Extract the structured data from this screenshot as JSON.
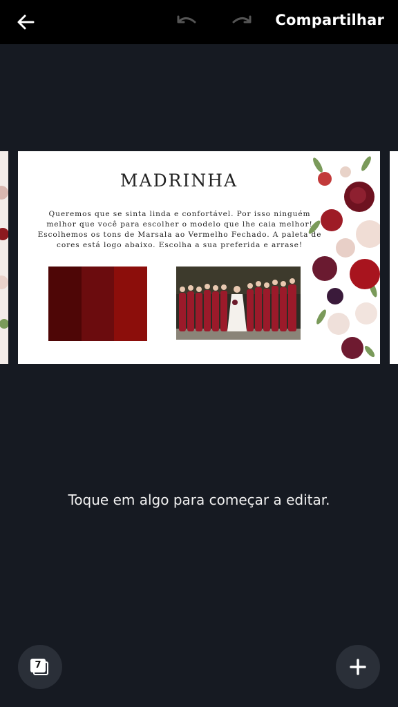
{
  "topbar": {
    "back_icon": "arrow-left-icon",
    "undo_icon": "undo-icon",
    "redo_icon": "redo-icon",
    "share_label": "Compartilhar"
  },
  "design": {
    "title": "MADRINHA",
    "description": "Queremos que se sinta linda e confortável. Por isso ninguém melhor que você para escolher o modelo que lhe caia melhor! Escolhemos os tons de Marsala ao Vermelho Fechado. A paleta de cores está logo abaixo. Escolha a sua preferida e arrase!",
    "palette": [
      "#4e0606",
      "#6b0c0e",
      "#8c0e0b"
    ]
  },
  "editor": {
    "hint": "Toque em algo para começar a editar.",
    "pages_count": "7",
    "pages_icon": "pages-icon",
    "add_icon": "plus-icon"
  }
}
